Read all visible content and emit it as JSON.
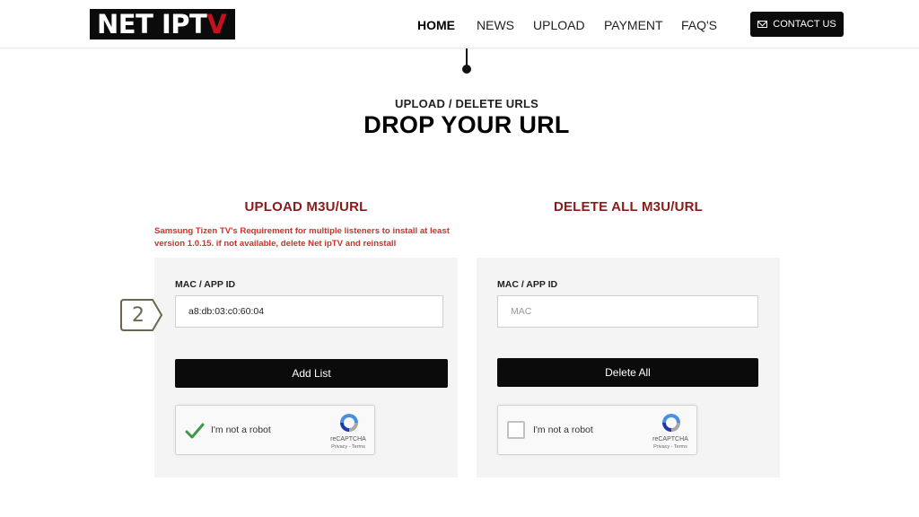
{
  "logo": {
    "text_main": "NET IPT",
    "text_accent": "V"
  },
  "nav": {
    "items": [
      {
        "label": "HOME",
        "active": true
      },
      {
        "label": "NEWS",
        "active": false
      },
      {
        "label": "UPLOAD",
        "active": false
      },
      {
        "label": "PAYMENT",
        "active": false
      },
      {
        "label": "FAQ'S",
        "active": false
      }
    ],
    "contact_label": "CONTACT US"
  },
  "section": {
    "subtitle": "UPLOAD / DELETE URLS",
    "title": "DROP YOUR URL"
  },
  "upload_panel": {
    "heading": "UPLOAD M3U/URL",
    "warning": "Samsung Tizen TV's Requirement for multiple listeners to install at least version 1.0.15. if not available, delete Net ipTV and reinstall",
    "field_label": "MAC / APP ID",
    "field_value": "a8:db:03:c0:60:04",
    "button_label": "Add List",
    "captcha": {
      "label": "I'm not a robot",
      "checked": true,
      "brand": "reCAPTCHA",
      "links": "Privacy - Terms"
    }
  },
  "delete_panel": {
    "heading": "DELETE ALL M3U/URL",
    "field_label": "MAC / APP ID",
    "field_placeholder": "MAC",
    "button_label": "Delete All",
    "captcha": {
      "label": "I'm not a robot",
      "checked": false,
      "brand": "reCAPTCHA",
      "links": "Privacy - Terms"
    }
  },
  "step_badge": "2",
  "colors": {
    "heading_red": "#8b1a1a",
    "warning_red": "#d0312d",
    "button_black": "#0b0b0b",
    "check_green": "#3a9a4a"
  },
  "icons": [
    "mail-icon",
    "checkmark-icon",
    "recaptcha-logo-icon",
    "arrow-badge-icon"
  ]
}
